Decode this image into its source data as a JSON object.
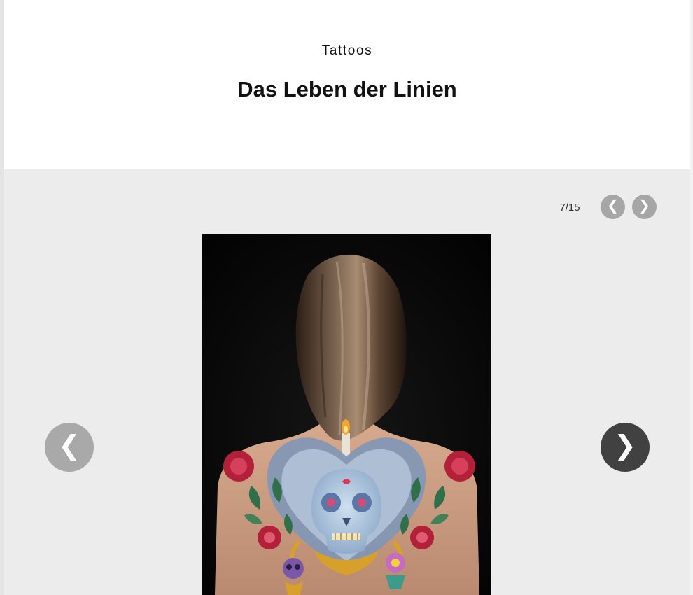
{
  "article": {
    "kicker": "Tattoos",
    "headline": "Das Leben der Linien"
  },
  "gallery": {
    "counter": "7/15",
    "current_index": 7,
    "total": 15,
    "controls": {
      "prev_icon": "❮",
      "next_icon": "❯"
    },
    "image": {
      "subject_colors": {
        "background": "#050505",
        "hair": "#5a4636",
        "skin": "#c99a80",
        "tattoo_blue": "#8aa6c8",
        "tattoo_red": "#b3203a",
        "tattoo_green": "#2f6f4a",
        "tattoo_gold": "#d6a02a"
      }
    }
  }
}
